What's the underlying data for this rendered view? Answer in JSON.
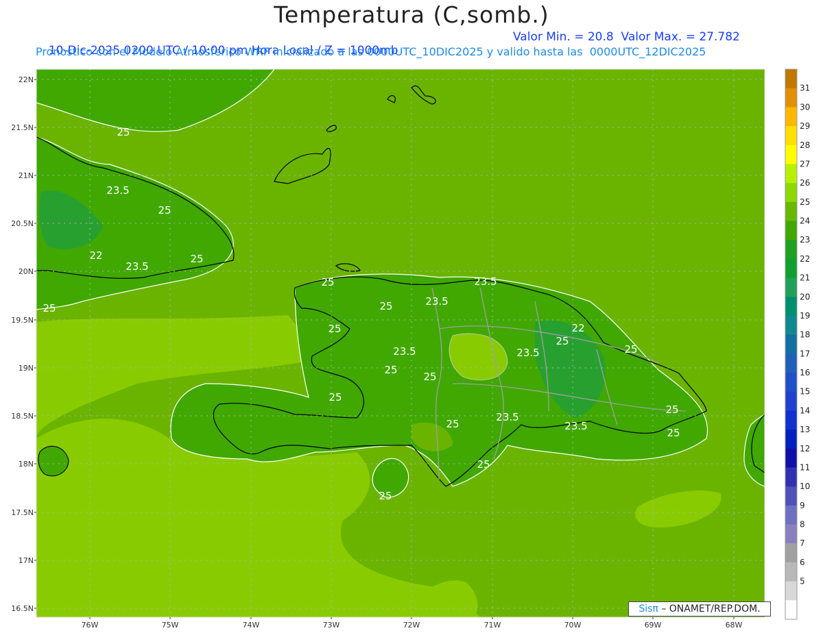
{
  "title": "Temperatura (C,somb.)",
  "subtitle_left": "10-Dic-2025 0200 UTC / 10:00 pm Hora Local / Z = 1000mb",
  "subtitle_right": "Valor Min. = 20.8  Valor Max. = 27.782",
  "subtitle_2": "Pronostico con el Modelo Atmosferico WRF inicializado a las 0000UTC_10DIC2025 y valido hasta las  0000UTC_12DIC2025",
  "credit_brand": "Sisπ",
  "credit_text": "– ONAMET/REP.DOM.",
  "lat_labels": [
    "22N",
    "21.5N",
    "21N",
    "20.5N",
    "20N",
    "19.5N",
    "19N",
    "18.5N",
    "18N",
    "17.5N",
    "17N",
    "16.5N"
  ],
  "lon_labels": [
    "76W",
    "75W",
    "74W",
    "73W",
    "72W",
    "71W",
    "70W",
    "69W",
    "68W"
  ],
  "colorbar_labels": [
    "31",
    "30",
    "29",
    "28",
    "27",
    "26",
    "25",
    "24",
    "23",
    "22",
    "21",
    "20",
    "19",
    "18",
    "17",
    "16",
    "15",
    "14",
    "13",
    "12",
    "11",
    "10",
    "9",
    "8",
    "7",
    "6",
    "5"
  ],
  "colorbar_colors": [
    "#c07800",
    "#e09000",
    "#ffb800",
    "#ffe000",
    "#ffff00",
    "#b8f000",
    "#8cd800",
    "#68b800",
    "#40a800",
    "#20a020",
    "#10a030",
    "#20a058",
    "#009070",
    "#108890",
    "#1070a0",
    "#2060b8",
    "#2050c8",
    "#2040d0",
    "#1030d0",
    "#0020c0",
    "#1010a8",
    "#3030b0",
    "#5050b8",
    "#7070c0",
    "#8a80c0",
    "#a0a0a0",
    "#b8b8b8",
    "#d8d8d8",
    "#ffffff"
  ],
  "contour_labels": [
    "25",
    "23.5",
    "25",
    "22",
    "23.5",
    "25",
    "25",
    "25",
    "25",
    "23.5",
    "23.5",
    "25",
    "22",
    "23.5",
    "25",
    "25",
    "25",
    "23.5",
    "25",
    "25",
    "25",
    "23.5",
    "23.5",
    "25",
    "25",
    "25",
    "25"
  ]
}
